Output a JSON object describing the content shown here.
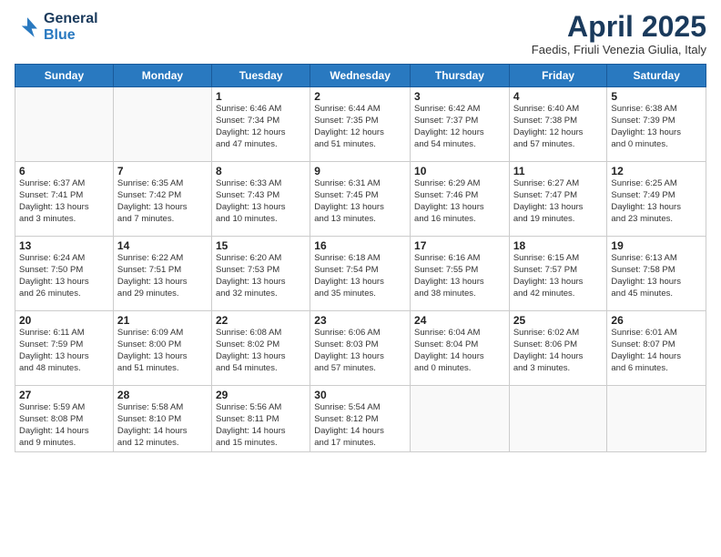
{
  "header": {
    "logo_line1": "General",
    "logo_line2": "Blue",
    "month_title": "April 2025",
    "subtitle": "Faedis, Friuli Venezia Giulia, Italy"
  },
  "weekdays": [
    "Sunday",
    "Monday",
    "Tuesday",
    "Wednesday",
    "Thursday",
    "Friday",
    "Saturday"
  ],
  "weeks": [
    [
      {
        "day": "",
        "info": ""
      },
      {
        "day": "",
        "info": ""
      },
      {
        "day": "1",
        "info": "Sunrise: 6:46 AM\nSunset: 7:34 PM\nDaylight: 12 hours\nand 47 minutes."
      },
      {
        "day": "2",
        "info": "Sunrise: 6:44 AM\nSunset: 7:35 PM\nDaylight: 12 hours\nand 51 minutes."
      },
      {
        "day": "3",
        "info": "Sunrise: 6:42 AM\nSunset: 7:37 PM\nDaylight: 12 hours\nand 54 minutes."
      },
      {
        "day": "4",
        "info": "Sunrise: 6:40 AM\nSunset: 7:38 PM\nDaylight: 12 hours\nand 57 minutes."
      },
      {
        "day": "5",
        "info": "Sunrise: 6:38 AM\nSunset: 7:39 PM\nDaylight: 13 hours\nand 0 minutes."
      }
    ],
    [
      {
        "day": "6",
        "info": "Sunrise: 6:37 AM\nSunset: 7:41 PM\nDaylight: 13 hours\nand 3 minutes."
      },
      {
        "day": "7",
        "info": "Sunrise: 6:35 AM\nSunset: 7:42 PM\nDaylight: 13 hours\nand 7 minutes."
      },
      {
        "day": "8",
        "info": "Sunrise: 6:33 AM\nSunset: 7:43 PM\nDaylight: 13 hours\nand 10 minutes."
      },
      {
        "day": "9",
        "info": "Sunrise: 6:31 AM\nSunset: 7:45 PM\nDaylight: 13 hours\nand 13 minutes."
      },
      {
        "day": "10",
        "info": "Sunrise: 6:29 AM\nSunset: 7:46 PM\nDaylight: 13 hours\nand 16 minutes."
      },
      {
        "day": "11",
        "info": "Sunrise: 6:27 AM\nSunset: 7:47 PM\nDaylight: 13 hours\nand 19 minutes."
      },
      {
        "day": "12",
        "info": "Sunrise: 6:25 AM\nSunset: 7:49 PM\nDaylight: 13 hours\nand 23 minutes."
      }
    ],
    [
      {
        "day": "13",
        "info": "Sunrise: 6:24 AM\nSunset: 7:50 PM\nDaylight: 13 hours\nand 26 minutes."
      },
      {
        "day": "14",
        "info": "Sunrise: 6:22 AM\nSunset: 7:51 PM\nDaylight: 13 hours\nand 29 minutes."
      },
      {
        "day": "15",
        "info": "Sunrise: 6:20 AM\nSunset: 7:53 PM\nDaylight: 13 hours\nand 32 minutes."
      },
      {
        "day": "16",
        "info": "Sunrise: 6:18 AM\nSunset: 7:54 PM\nDaylight: 13 hours\nand 35 minutes."
      },
      {
        "day": "17",
        "info": "Sunrise: 6:16 AM\nSunset: 7:55 PM\nDaylight: 13 hours\nand 38 minutes."
      },
      {
        "day": "18",
        "info": "Sunrise: 6:15 AM\nSunset: 7:57 PM\nDaylight: 13 hours\nand 42 minutes."
      },
      {
        "day": "19",
        "info": "Sunrise: 6:13 AM\nSunset: 7:58 PM\nDaylight: 13 hours\nand 45 minutes."
      }
    ],
    [
      {
        "day": "20",
        "info": "Sunrise: 6:11 AM\nSunset: 7:59 PM\nDaylight: 13 hours\nand 48 minutes."
      },
      {
        "day": "21",
        "info": "Sunrise: 6:09 AM\nSunset: 8:00 PM\nDaylight: 13 hours\nand 51 minutes."
      },
      {
        "day": "22",
        "info": "Sunrise: 6:08 AM\nSunset: 8:02 PM\nDaylight: 13 hours\nand 54 minutes."
      },
      {
        "day": "23",
        "info": "Sunrise: 6:06 AM\nSunset: 8:03 PM\nDaylight: 13 hours\nand 57 minutes."
      },
      {
        "day": "24",
        "info": "Sunrise: 6:04 AM\nSunset: 8:04 PM\nDaylight: 14 hours\nand 0 minutes."
      },
      {
        "day": "25",
        "info": "Sunrise: 6:02 AM\nSunset: 8:06 PM\nDaylight: 14 hours\nand 3 minutes."
      },
      {
        "day": "26",
        "info": "Sunrise: 6:01 AM\nSunset: 8:07 PM\nDaylight: 14 hours\nand 6 minutes."
      }
    ],
    [
      {
        "day": "27",
        "info": "Sunrise: 5:59 AM\nSunset: 8:08 PM\nDaylight: 14 hours\nand 9 minutes."
      },
      {
        "day": "28",
        "info": "Sunrise: 5:58 AM\nSunset: 8:10 PM\nDaylight: 14 hours\nand 12 minutes."
      },
      {
        "day": "29",
        "info": "Sunrise: 5:56 AM\nSunset: 8:11 PM\nDaylight: 14 hours\nand 15 minutes."
      },
      {
        "day": "30",
        "info": "Sunrise: 5:54 AM\nSunset: 8:12 PM\nDaylight: 14 hours\nand 17 minutes."
      },
      {
        "day": "",
        "info": ""
      },
      {
        "day": "",
        "info": ""
      },
      {
        "day": "",
        "info": ""
      }
    ]
  ]
}
